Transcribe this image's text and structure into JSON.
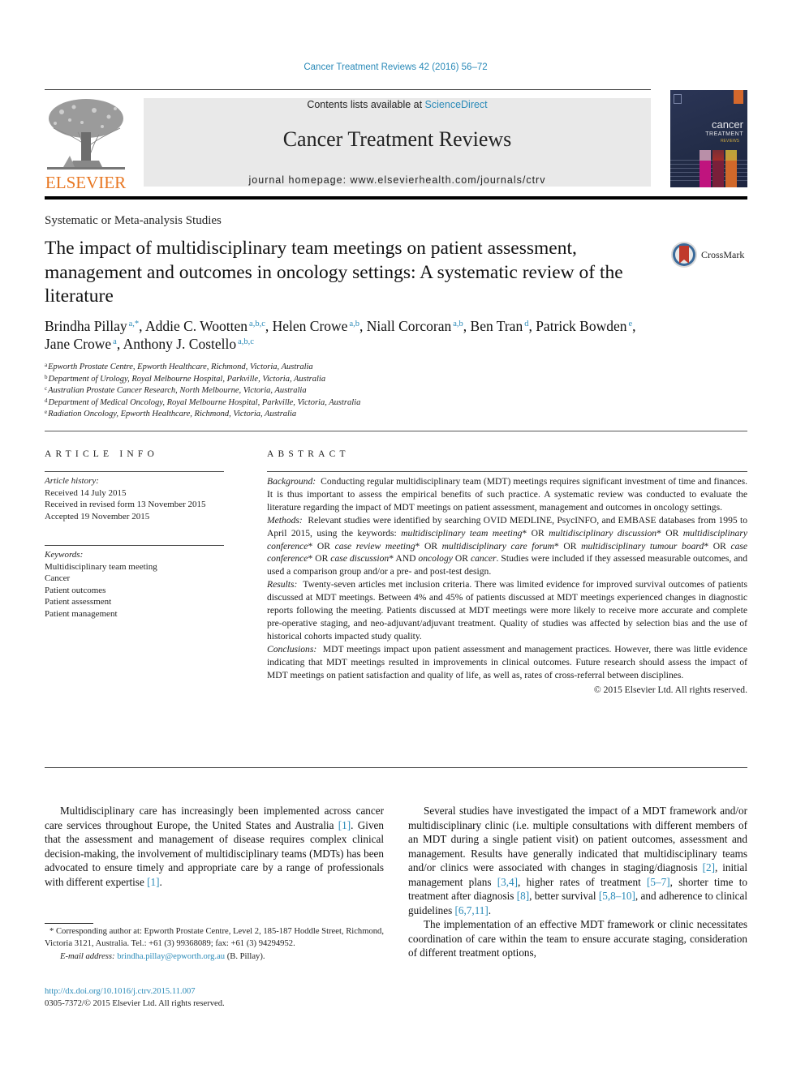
{
  "header": {
    "journal_ref": "Cancer Treatment Reviews 42 (2016) 56–72",
    "publisher": "ELSEVIER",
    "contents_prefix": "Contents lists available at ",
    "contents_link": "ScienceDirect",
    "journal_title": "Cancer Treatment Reviews",
    "homepage": "journal homepage: www.elsevierhealth.com/journals/ctrv",
    "cover": {
      "title_line1": "cancer",
      "title_line2": "TREATMENT",
      "title_line3": "REVIEWS"
    },
    "colors": {
      "link": "#2a8ab8",
      "elsevier_orange": "#e87722",
      "masthead_bg": "#e9e9e9"
    }
  },
  "article": {
    "section_type": "Systematic or Meta-analysis Studies",
    "title": "The impact of multidisciplinary team meetings on patient assessment, management and outcomes in oncology settings: A systematic review of the literature",
    "crossmark_label": "CrossMark",
    "authors": [
      {
        "name": "Brindha Pillay",
        "aff": "a,*",
        "sep": ", "
      },
      {
        "name": "Addie C. Wootten",
        "aff": "a,b,c",
        "sep": ", "
      },
      {
        "name": "Helen Crowe",
        "aff": "a,b",
        "sep": ", "
      },
      {
        "name": "Niall Corcoran",
        "aff": "a,b",
        "sep": ", "
      },
      {
        "name": "Ben Tran",
        "aff": "d",
        "sep": ", "
      },
      {
        "name": "Patrick Bowden",
        "aff": "e",
        "sep": ","
      },
      {
        "name": "Jane Crowe",
        "aff": "a",
        "sep": ", "
      },
      {
        "name": "Anthony J. Costello",
        "aff": "a,b,c",
        "sep": ""
      }
    ],
    "affiliations": [
      {
        "key": "a",
        "text": "Epworth Prostate Centre, Epworth Healthcare, Richmond, Victoria, Australia"
      },
      {
        "key": "b",
        "text": "Department of Urology, Royal Melbourne Hospital, Parkville, Victoria, Australia"
      },
      {
        "key": "c",
        "text": "Australian Prostate Cancer Research, North Melbourne, Victoria, Australia"
      },
      {
        "key": "d",
        "text": "Department of Medical Oncology, Royal Melbourne Hospital, Parkville, Victoria, Australia"
      },
      {
        "key": "e",
        "text": "Radiation Oncology, Epworth Healthcare, Richmond, Victoria, Australia"
      }
    ]
  },
  "article_info": {
    "heading": "ARTICLE INFO",
    "history_label": "Article history:",
    "history": [
      "Received 14 July 2015",
      "Received in revised form 13 November 2015",
      "Accepted 19 November 2015"
    ],
    "keywords_label": "Keywords:",
    "keywords": [
      "Multidisciplinary team meeting",
      "Cancer",
      "Patient outcomes",
      "Patient assessment",
      "Patient management"
    ]
  },
  "abstract": {
    "heading": "ABSTRACT",
    "background_label": "Background:",
    "background": "Conducting regular multidisciplinary team (MDT) meetings requires significant investment of time and finances. It is thus important to assess the empirical benefits of such practice. A systematic review was conducted to evaluate the literature regarding the impact of MDT meetings on patient assessment, management and outcomes in oncology settings.",
    "methods_label": "Methods:",
    "methods_parts": [
      {
        "t": "Relevant studies were identified by searching OVID MEDLINE, PsycINFO, and EMBASE databases from 1995 to April 2015, using the keywords: ",
        "i": false
      },
      {
        "t": "multidisciplinary team meeting",
        "i": true
      },
      {
        "t": "* OR ",
        "i": false
      },
      {
        "t": "multidisciplinary discussion",
        "i": true
      },
      {
        "t": "* OR ",
        "i": false
      },
      {
        "t": "multidisciplinary conference",
        "i": true
      },
      {
        "t": "* OR ",
        "i": false
      },
      {
        "t": "case review meeting",
        "i": true
      },
      {
        "t": "* OR ",
        "i": false
      },
      {
        "t": "multidisciplinary care forum",
        "i": true
      },
      {
        "t": "* OR ",
        "i": false
      },
      {
        "t": "multidisciplinary tumour board",
        "i": true
      },
      {
        "t": "* OR ",
        "i": false
      },
      {
        "t": "case conference",
        "i": true
      },
      {
        "t": "* OR ",
        "i": false
      },
      {
        "t": "case discussion",
        "i": true
      },
      {
        "t": "* AND ",
        "i": false
      },
      {
        "t": "oncology",
        "i": true
      },
      {
        "t": " OR ",
        "i": false
      },
      {
        "t": "cancer",
        "i": true
      },
      {
        "t": ". Studies were included if they assessed measurable outcomes, and used a comparison group and/or a pre- and post-test design.",
        "i": false
      }
    ],
    "results_label": "Results:",
    "results": "Twenty-seven articles met inclusion criteria. There was limited evidence for improved survival outcomes of patients discussed at MDT meetings. Between 4% and 45% of patients discussed at MDT meetings experienced changes in diagnostic reports following the meeting. Patients discussed at MDT meetings were more likely to receive more accurate and complete pre-operative staging, and neo-adjuvant/adjuvant treatment. Quality of studies was affected by selection bias and the use of historical cohorts impacted study quality.",
    "conclusions_label": "Conclusions:",
    "conclusions": "MDT meetings impact upon patient assessment and management practices. However, there was little evidence indicating that MDT meetings resulted in improvements in clinical outcomes. Future research should assess the impact of MDT meetings on patient satisfaction and quality of life, as well as, rates of cross-referral between disciplines.",
    "copyright": "© 2015 Elsevier Ltd. All rights reserved."
  },
  "body": {
    "left_col": [
      [
        {
          "t": "Multidisciplinary care has increasingly been implemented across cancer care services throughout Europe, the United States and Australia ",
          "ref": false
        },
        {
          "t": "[1]",
          "ref": true
        },
        {
          "t": ". Given that the assessment and management of disease requires complex clinical decision-making, the involvement of multidisciplinary teams (MDTs) has been advocated to ensure timely and appropriate care by a range of professionals with different expertise ",
          "ref": false
        },
        {
          "t": "[1]",
          "ref": true
        },
        {
          "t": ".",
          "ref": false
        }
      ]
    ],
    "right_col": [
      [
        {
          "t": "Several studies have investigated the impact of a MDT framework and/or multidisciplinary clinic (i.e. multiple consultations with different members of an MDT during a single patient visit) on patient outcomes, assessment and management. Results have generally indicated that multidisciplinary teams and/or clinics were associated with changes in staging/diagnosis ",
          "ref": false
        },
        {
          "t": "[2]",
          "ref": true
        },
        {
          "t": ", initial management plans ",
          "ref": false
        },
        {
          "t": "[3,4]",
          "ref": true
        },
        {
          "t": ", higher rates of treatment ",
          "ref": false
        },
        {
          "t": "[5–7]",
          "ref": true
        },
        {
          "t": ", shorter time to treatment after diagnosis ",
          "ref": false
        },
        {
          "t": "[8]",
          "ref": true
        },
        {
          "t": ", better survival ",
          "ref": false
        },
        {
          "t": "[5,8–10]",
          "ref": true
        },
        {
          "t": ", and adherence to clinical guidelines ",
          "ref": false
        },
        {
          "t": "[6,7,11]",
          "ref": true
        },
        {
          "t": ".",
          "ref": false
        }
      ],
      [
        {
          "t": "The implementation of an effective MDT framework or clinic necessitates coordination of care within the team to ensure accurate staging, consideration of different treatment options,",
          "ref": false
        }
      ]
    ]
  },
  "footnote": {
    "star": "*",
    "corresponding": "Corresponding author at: Epworth Prostate Centre, Level 2, 185-187 Hoddle Street, Richmond, Victoria 3121, Australia. Tel.: +61 (3) 99368089; fax: +61 (3) 94294952.",
    "email_label": "E-mail address:",
    "email": "brindha.pillay@epworth.org.au",
    "email_suffix": " (B. Pillay).",
    "doi": "http://dx.doi.org/10.1016/j.ctrv.2015.11.007",
    "issn_copyright": "0305-7372/© 2015 Elsevier Ltd. All rights reserved."
  }
}
